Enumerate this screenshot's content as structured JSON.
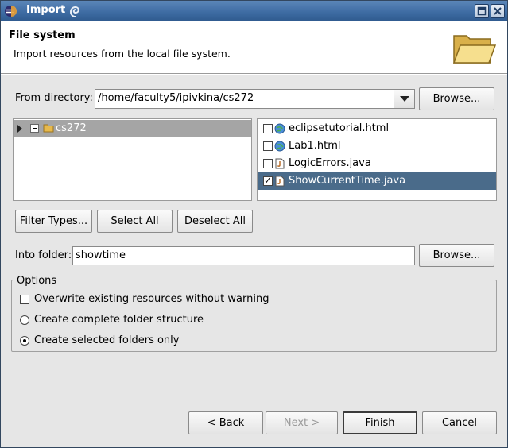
{
  "window": {
    "title": "Import",
    "accent": "#3e6ca3"
  },
  "header": {
    "title": "File system",
    "description": "Import resources from the local file system."
  },
  "from_directory": {
    "label": "From directory:",
    "value": "/home/faculty5/ipivkina/cs272",
    "browse_label": "Browse..."
  },
  "tree": {
    "items": [
      {
        "label": "cs272",
        "selected": true,
        "expanded": true
      }
    ]
  },
  "files": [
    {
      "name": "eclipsetutorial.html",
      "icon": "html-globe-icon",
      "checked": false,
      "selected": false
    },
    {
      "name": "Lab1.html",
      "icon": "html-globe-icon",
      "checked": false,
      "selected": false
    },
    {
      "name": "LogicErrors.java",
      "icon": "java-file-icon",
      "checked": false,
      "selected": false
    },
    {
      "name": "ShowCurrentTime.java",
      "icon": "java-file-icon",
      "checked": true,
      "selected": true
    }
  ],
  "selection_buttons": {
    "filter_types": "Filter Types...",
    "select_all": "Select All",
    "deselect_all": "Deselect All"
  },
  "into_folder": {
    "label": "Into folder:",
    "value": "showtime",
    "browse_label": "Browse..."
  },
  "options": {
    "title": "Options",
    "overwrite": {
      "label": "Overwrite existing resources without warning",
      "checked": false
    },
    "complete_structure": {
      "label": "Create complete folder structure",
      "selected": false
    },
    "selected_only": {
      "label": "Create selected folders only",
      "selected": true
    }
  },
  "footer": {
    "back": "< Back",
    "next": "Next >",
    "finish": "Finish",
    "cancel": "Cancel"
  }
}
